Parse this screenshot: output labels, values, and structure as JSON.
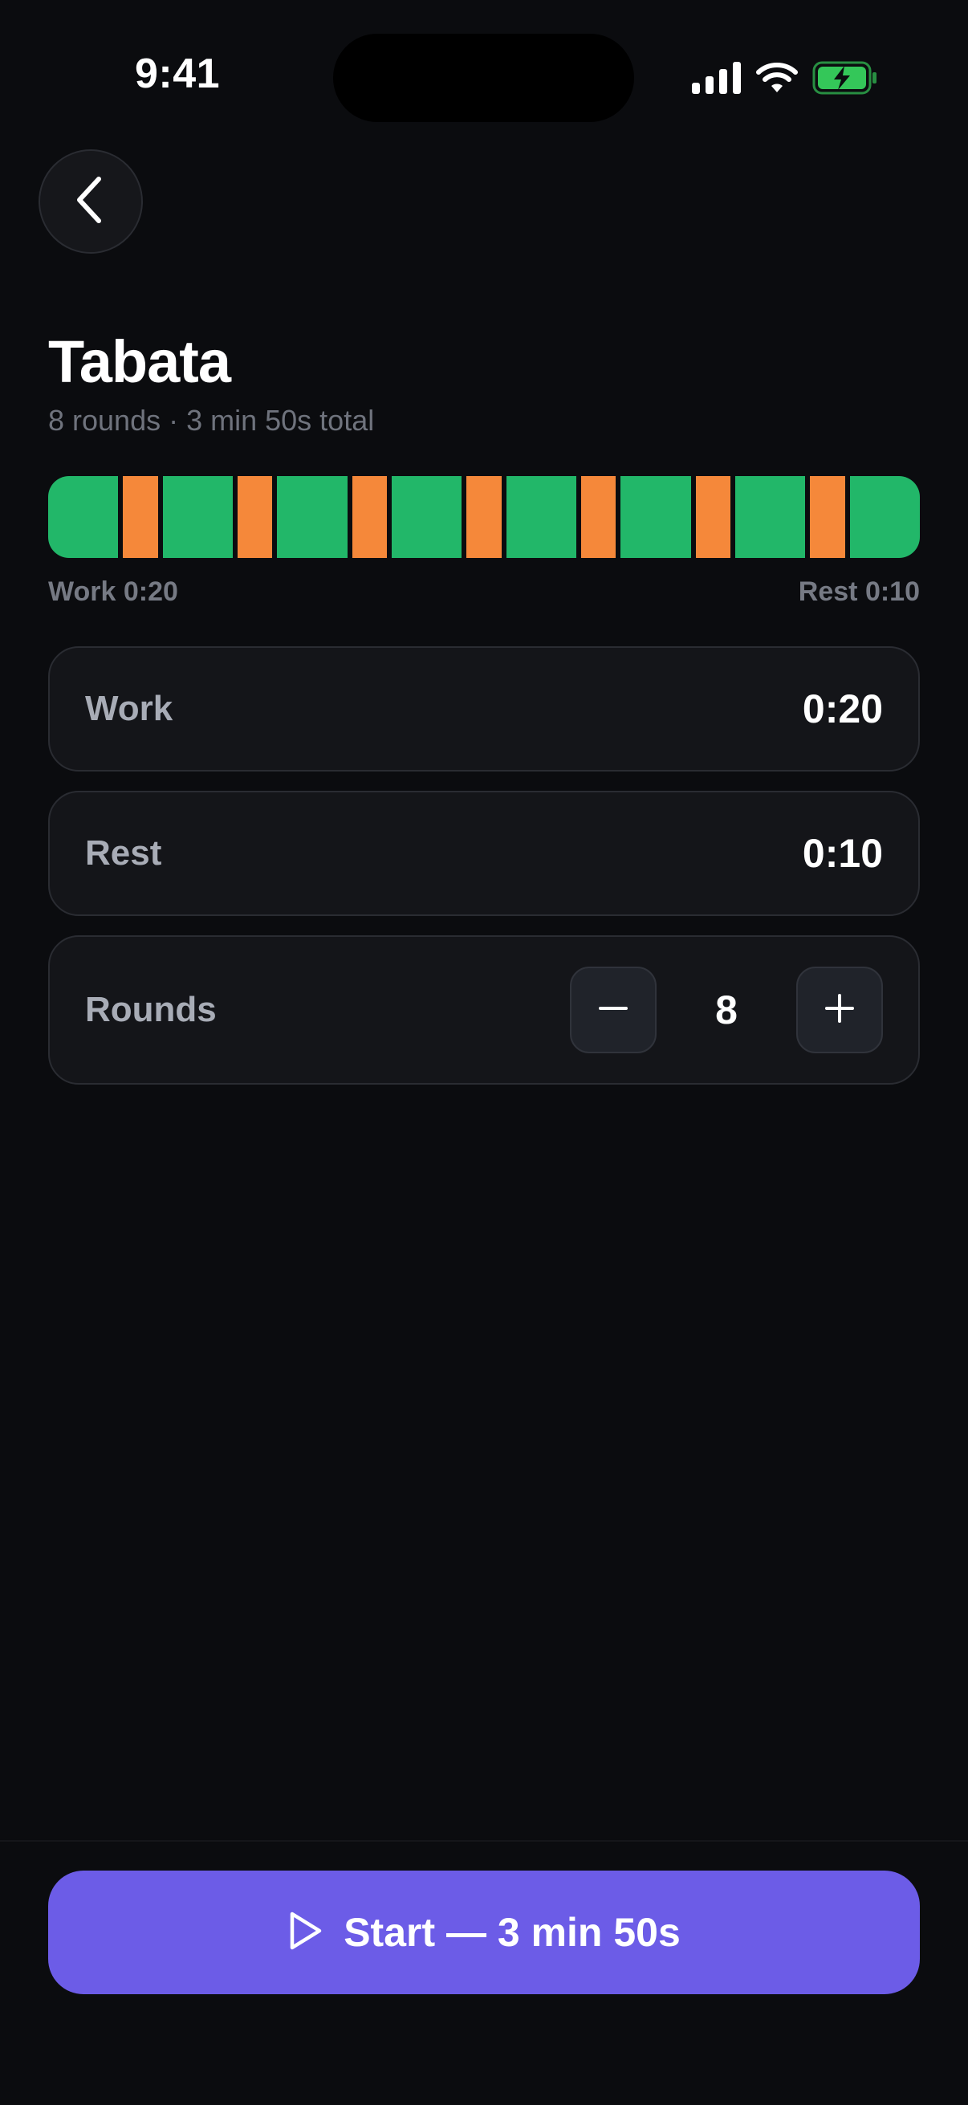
{
  "status_bar": {
    "time": "9:41",
    "battery_color": "#34c759"
  },
  "header": {
    "title": "Tabata",
    "subtitle": "8 rounds · 3 min 50s total"
  },
  "interval_bar": {
    "work_seconds": 20,
    "rest_seconds": 10,
    "rounds": 8,
    "work_color": "#22b769",
    "rest_color": "#f5883a",
    "left_label": "Work 0:20",
    "right_label": "Rest 0:10"
  },
  "settings": {
    "work": {
      "label": "Work",
      "value": "0:20"
    },
    "rest": {
      "label": "Rest",
      "value": "0:10"
    },
    "rounds": {
      "label": "Rounds",
      "value": "8"
    }
  },
  "icons": {
    "back": "chevron-left-icon",
    "decrement": "minus-icon",
    "increment": "plus-icon",
    "start": "play-icon"
  },
  "start_button": {
    "label": "Start — 3 min 50s",
    "color": "#6c5ce7"
  }
}
